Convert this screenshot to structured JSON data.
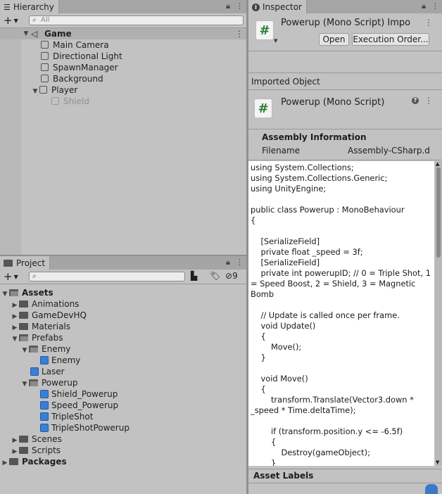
{
  "hierarchy": {
    "tab_label": "Hierarchy",
    "search_placeholder": "All",
    "scene_name": "Game",
    "items": [
      "Main Camera",
      "Directional Light",
      "SpawnManager",
      "Background",
      "Player",
      "Shield"
    ]
  },
  "project": {
    "tab_label": "Project",
    "hidden_count": "9",
    "tree": {
      "assets": "Assets",
      "animations": "Animations",
      "gamedevhq": "GameDevHQ",
      "materials": "Materials",
      "prefabs": "Prefabs",
      "enemy_folder": "Enemy",
      "enemy_prefab": "Enemy",
      "laser": "Laser",
      "powerup_folder": "Powerup",
      "shield_powerup": "Shield_Powerup",
      "speed_powerup": "Speed_Powerup",
      "tripleshot": "TripleShot",
      "tripleshot_powerup": "TripleShotPowerup",
      "scenes": "Scenes",
      "scripts": "Scripts",
      "packages": "Packages"
    }
  },
  "inspector": {
    "tab_label": "Inspector",
    "title": "Powerup (Mono Script) Impo",
    "open_button": "Open",
    "execution_order_button": "Execution Order...",
    "imported_object_label": "Imported Object",
    "object_title": "Powerup (Mono Script)",
    "assembly_header": "Assembly Information",
    "filename_label": "Filename",
    "filename_value": "Assembly-CSharp.dl",
    "code": "using System.Collections;\nusing System.Collections.Generic;\nusing UnityEngine;\n\npublic class Powerup : MonoBehaviour\n{\n\n    [SerializeField]\n    private float _speed = 3f;\n    [SerializeField]\n    private int powerupID; // 0 = Triple Shot, 1 = Speed Boost, 2 = Shield, 3 = Magnetic Bomb\n\n    // Update is called once per frame.\n    void Update()\n    {\n        Move();\n    }\n\n    void Move()\n    {\n        transform.Translate(Vector3.down * _speed * Time.deltaTime);\n\n        if (transform.position.y <= -6.5f)\n        {\n            Destroy(gameObject);\n        }\n    }",
    "asset_labels": "Asset Labels"
  }
}
